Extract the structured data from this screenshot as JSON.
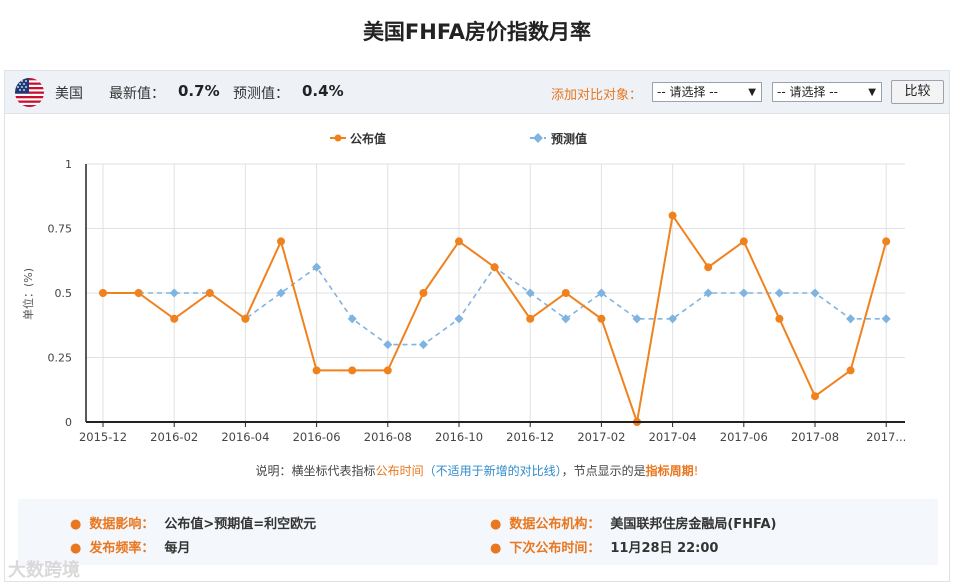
{
  "page": {
    "title": "美国FHFA房价指数月率"
  },
  "header": {
    "country": "美国",
    "latest_label": "最新值：",
    "latest_value": "0.7%",
    "forecast_label": "预测值：",
    "forecast_value": "0.4%",
    "compare_label": "添加对比对象：",
    "select1": "-- 请选择 --",
    "select2": "-- 请选择 --",
    "compare_button": "比较"
  },
  "note": {
    "p1": "说明：横坐标代表指标",
    "p2": "公布时间",
    "p3": "（不适用于新增的对比线）",
    "p4": "，节点显示的是",
    "p5": "指标周期",
    "p6": "!"
  },
  "info": {
    "impact_label": "数据影响：",
    "impact_value": "公布值>预期值=利空欧元",
    "agency_label": "数据公布机构：",
    "agency_value": "美国联邦住房金融局(FHFA)",
    "freq_label": "发布频率：",
    "freq_value": "每月",
    "next_label": "下次公布时间：",
    "next_value": "11月28日 22:00"
  },
  "watermark": "大数跨境",
  "colors": {
    "actual": "#f0821e",
    "forecast": "#7fb3e0",
    "accent": "#e8771f",
    "axis": "#222222",
    "grid": "#e2e2e2"
  },
  "chart_data": {
    "type": "line",
    "title": "",
    "ylabel": "单位：(%)",
    "ylim": [
      0,
      1
    ],
    "yticks": [
      "0",
      "0.25",
      "0.5",
      "0.75",
      "1"
    ],
    "xtick_labels": [
      "2015-12",
      "2016-02",
      "2016-04",
      "2016-06",
      "2016-08",
      "2016-10",
      "2016-12",
      "2017-02",
      "2017-04",
      "2017-06",
      "2017-08",
      "2017..."
    ],
    "legend_position": "top",
    "series": [
      {
        "name": "公布值",
        "values": [
          0.5,
          0.5,
          0.4,
          0.5,
          0.4,
          0.7,
          0.2,
          0.2,
          0.2,
          0.5,
          0.7,
          0.6,
          0.4,
          0.5,
          0.4,
          0.0,
          0.8,
          0.6,
          0.7,
          0.4,
          0.1,
          0.2,
          0.7
        ]
      },
      {
        "name": "预测值",
        "values": [
          0.5,
          0.5,
          0.5,
          0.5,
          0.4,
          0.5,
          0.6,
          0.4,
          0.3,
          0.3,
          0.4,
          0.6,
          0.5,
          0.4,
          0.5,
          0.4,
          0.4,
          0.5,
          0.5,
          0.5,
          0.5,
          0.4,
          0.4
        ]
      }
    ]
  }
}
